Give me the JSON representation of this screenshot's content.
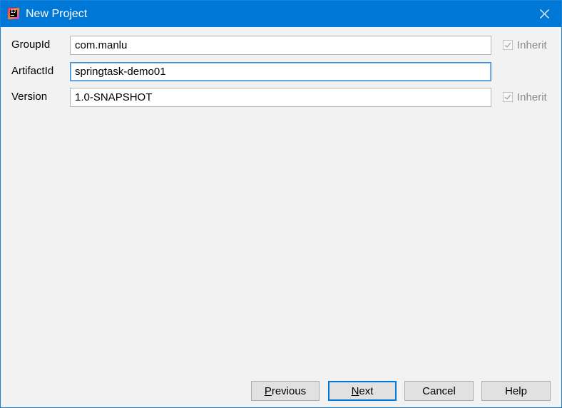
{
  "window": {
    "title": "New Project",
    "icon": "intellij-idea-icon",
    "icon_glyph": "IJ"
  },
  "form": {
    "group_id": {
      "label": "GroupId",
      "value": "com.manlu",
      "inherit_label": "Inherit",
      "inherit_checked": true
    },
    "artifact_id": {
      "label": "ArtifactId",
      "value": "springtask-demo01"
    },
    "version": {
      "label": "Version",
      "value": "1.0-SNAPSHOT",
      "inherit_label": "Inherit",
      "inherit_checked": true
    }
  },
  "buttons": {
    "previous": {
      "mnemonic": "P",
      "rest": "revious"
    },
    "next": {
      "mnemonic": "N",
      "rest": "ext"
    },
    "cancel": "Cancel",
    "help": "Help"
  },
  "colors": {
    "titlebar": "#0078d7",
    "background": "#f2f2f2",
    "focus_border": "#3d8fd6"
  }
}
